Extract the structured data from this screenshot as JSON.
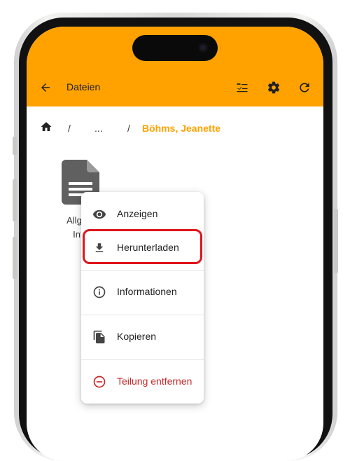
{
  "appbar": {
    "title": "Dateien",
    "icons": [
      "back-arrow-icon",
      "checklist-icon",
      "gear-icon",
      "refresh-icon"
    ],
    "background": "#ffa200"
  },
  "breadcrumb": {
    "home_icon": "home-icon",
    "separator_1": "/",
    "ellipsis": "...",
    "separator_2": "/",
    "current": "Böhms, Jeanette"
  },
  "file": {
    "icon": "document-icon",
    "label_line1": "Allgem",
    "label_line2": "Info"
  },
  "context_menu": {
    "items": [
      {
        "label": "Anzeigen",
        "icon": "eye-icon"
      },
      {
        "label": "Herunterladen",
        "icon": "download-icon",
        "highlighted": true
      },
      {
        "label": "Informationen",
        "icon": "info-icon"
      },
      {
        "label": "Kopieren",
        "icon": "copy-icon"
      },
      {
        "label": "Teilung entfernen",
        "icon": "minus-circle-icon",
        "color": "#c62828"
      }
    ]
  },
  "colors": {
    "accent": "#ffa200",
    "highlight_border": "#e0141b",
    "danger": "#c62828"
  }
}
